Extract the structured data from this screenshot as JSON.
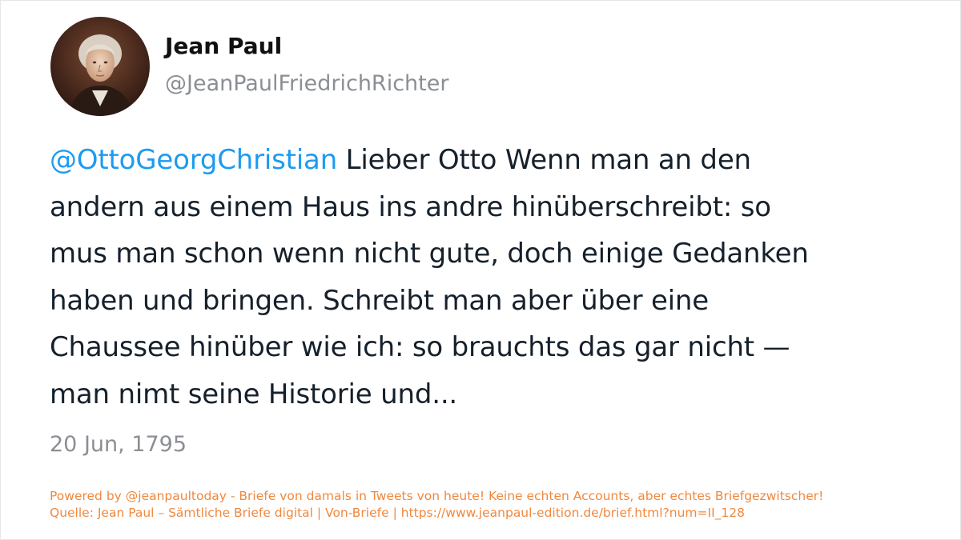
{
  "author": {
    "name": "Jean Paul",
    "handle": "@JeanPaulFriedrichRichter",
    "avatar_icon": "portrait-avatar"
  },
  "tweet": {
    "mention": "@OttoGeorgChristian",
    "lines": [
      " Lieber Otto Wenn man an den",
      "andern aus einem Haus ins andre hinüberschreibt: so",
      "mus man schon wenn nicht gute, doch einige Gedanken",
      "haben und bringen. Schreibt man aber über eine",
      "Chaussee hinüber wie ich: so brauchts das gar nicht —",
      "man nimt seine Historie und..."
    ],
    "date": "20 Jun, 1795"
  },
  "footer": {
    "line1": "Powered by @jeanpaultoday - Briefe von damals in Tweets von heute! Keine echten Accounts, aber echtes Briefgezwitscher!",
    "line2": "Quelle: Jean Paul – Sämtliche Briefe digital | Von-Briefe | https://www.jeanpaul-edition.de/brief.html?num=II_128"
  },
  "colors": {
    "mention": "#1d9bf0",
    "text": "#15202b",
    "muted": "#8b8f94",
    "footer": "#f0883e"
  }
}
